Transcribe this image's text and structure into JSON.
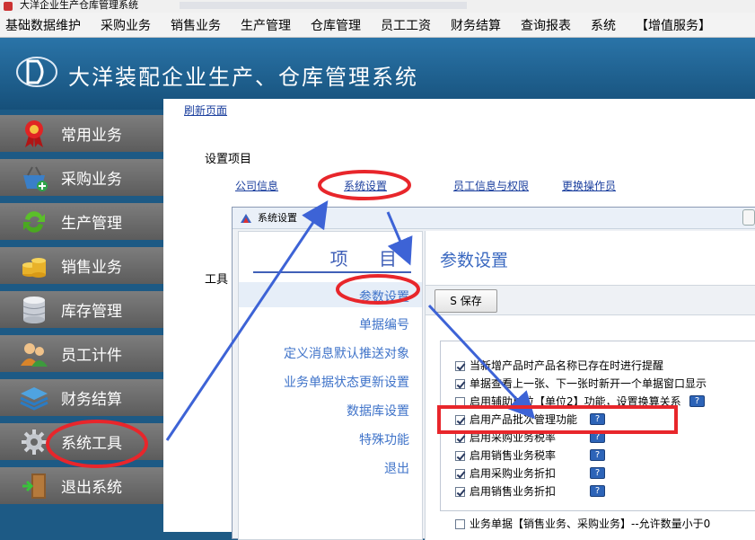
{
  "window": {
    "title": "大洋企业生产仓库管理系统"
  },
  "menu": [
    "基础数据维护",
    "采购业务",
    "销售业务",
    "生产管理",
    "仓库管理",
    "员工工资",
    "财务结算",
    "查询报表",
    "系统",
    "【增值服务】"
  ],
  "app": {
    "title": "大洋装配企业生产、仓库管理系统"
  },
  "sidebar": {
    "items": [
      {
        "label": "常用业务",
        "icon": "award-ribbon-icon"
      },
      {
        "label": "采购业务",
        "icon": "shopping-basket-icon"
      },
      {
        "label": "生产管理",
        "icon": "refresh-arrows-icon"
      },
      {
        "label": "销售业务",
        "icon": "coins-icon"
      },
      {
        "label": "库存管理",
        "icon": "database-icon"
      },
      {
        "label": "员工计件",
        "icon": "users-icon"
      },
      {
        "label": "财务结算",
        "icon": "layers-icon"
      },
      {
        "label": "系统工具",
        "icon": "gear-icon"
      },
      {
        "label": "退出系统",
        "icon": "exit-door-icon"
      }
    ]
  },
  "content": {
    "refresh": "刷新页面",
    "section_title": "设置项目",
    "links": [
      "公司信息",
      "系统设置",
      "员工信息与权限",
      "更换操作员"
    ],
    "tools_label": "工具"
  },
  "dialog": {
    "title": "系统设置",
    "left_header": "项 目",
    "items": [
      "参数设置",
      "单据编号",
      "定义消息默认推送对象",
      "业务单据状态更新设置",
      "数据库设置",
      "特殊功能",
      "退出"
    ],
    "right_header": "参数设置",
    "save_label": "S 保存",
    "options": [
      {
        "label": "当新增产品时产品名称已存在时进行提醒",
        "checked": true,
        "help": false
      },
      {
        "label": "单据查看上一张、下一张时新开一个单据窗口显示",
        "checked": true,
        "help": false
      },
      {
        "label": "启用辅助单位【单位2】功能，设置换算关系",
        "checked": false,
        "help": true
      },
      {
        "label": "启用产品批次管理功能",
        "checked": true,
        "help": true
      },
      {
        "label": "启用采购业务税率",
        "checked": true,
        "help": true
      },
      {
        "label": "启用销售业务税率",
        "checked": true,
        "help": true
      },
      {
        "label": "启用采购业务折扣",
        "checked": true,
        "help": true
      },
      {
        "label": "启用销售业务折扣",
        "checked": true,
        "help": true
      }
    ],
    "bottom_option": {
      "label": "业务单据【销售业务、采购业务】--允许数量小于0",
      "checked": false
    }
  },
  "colors": {
    "annotation_red": "#e8262b",
    "annotation_arrow": "#3d63d6"
  }
}
